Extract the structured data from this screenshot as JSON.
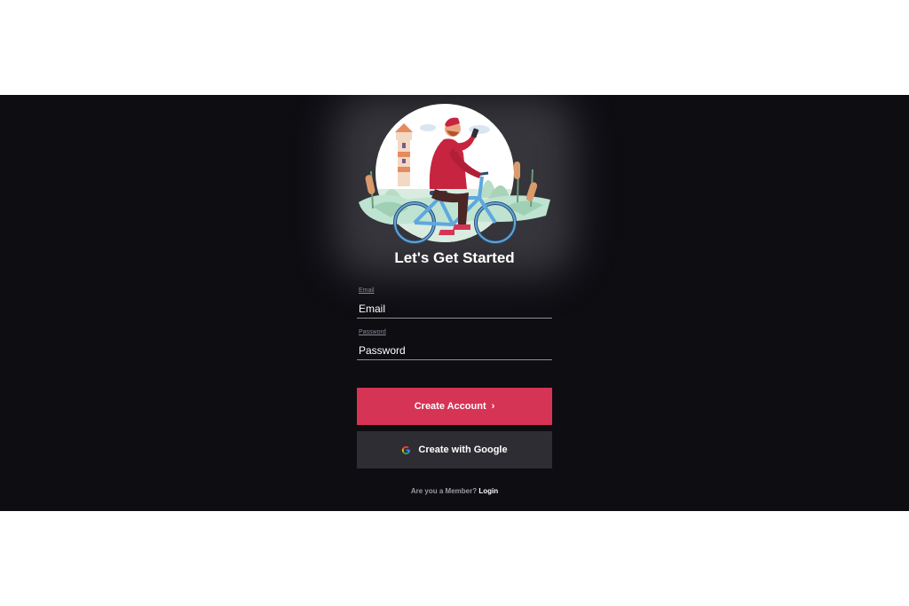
{
  "header": {
    "title": "Let's Get Started"
  },
  "form": {
    "email": {
      "label": "Email",
      "placeholder": "Email"
    },
    "password": {
      "label": "Password",
      "placeholder": "Password"
    }
  },
  "buttons": {
    "create_account": "Create Account",
    "create_google": "Create with Google"
  },
  "footer": {
    "question": "Are you a Member?",
    "login": "Login"
  },
  "icons": {
    "chevron": "chevron-right-icon",
    "google": "google-icon",
    "illustration": "cyclist-illustration"
  },
  "colors": {
    "background": "#0d0d12",
    "accent": "#d63455",
    "secondary_button": "#2d2d33",
    "text": "#ffffff"
  }
}
